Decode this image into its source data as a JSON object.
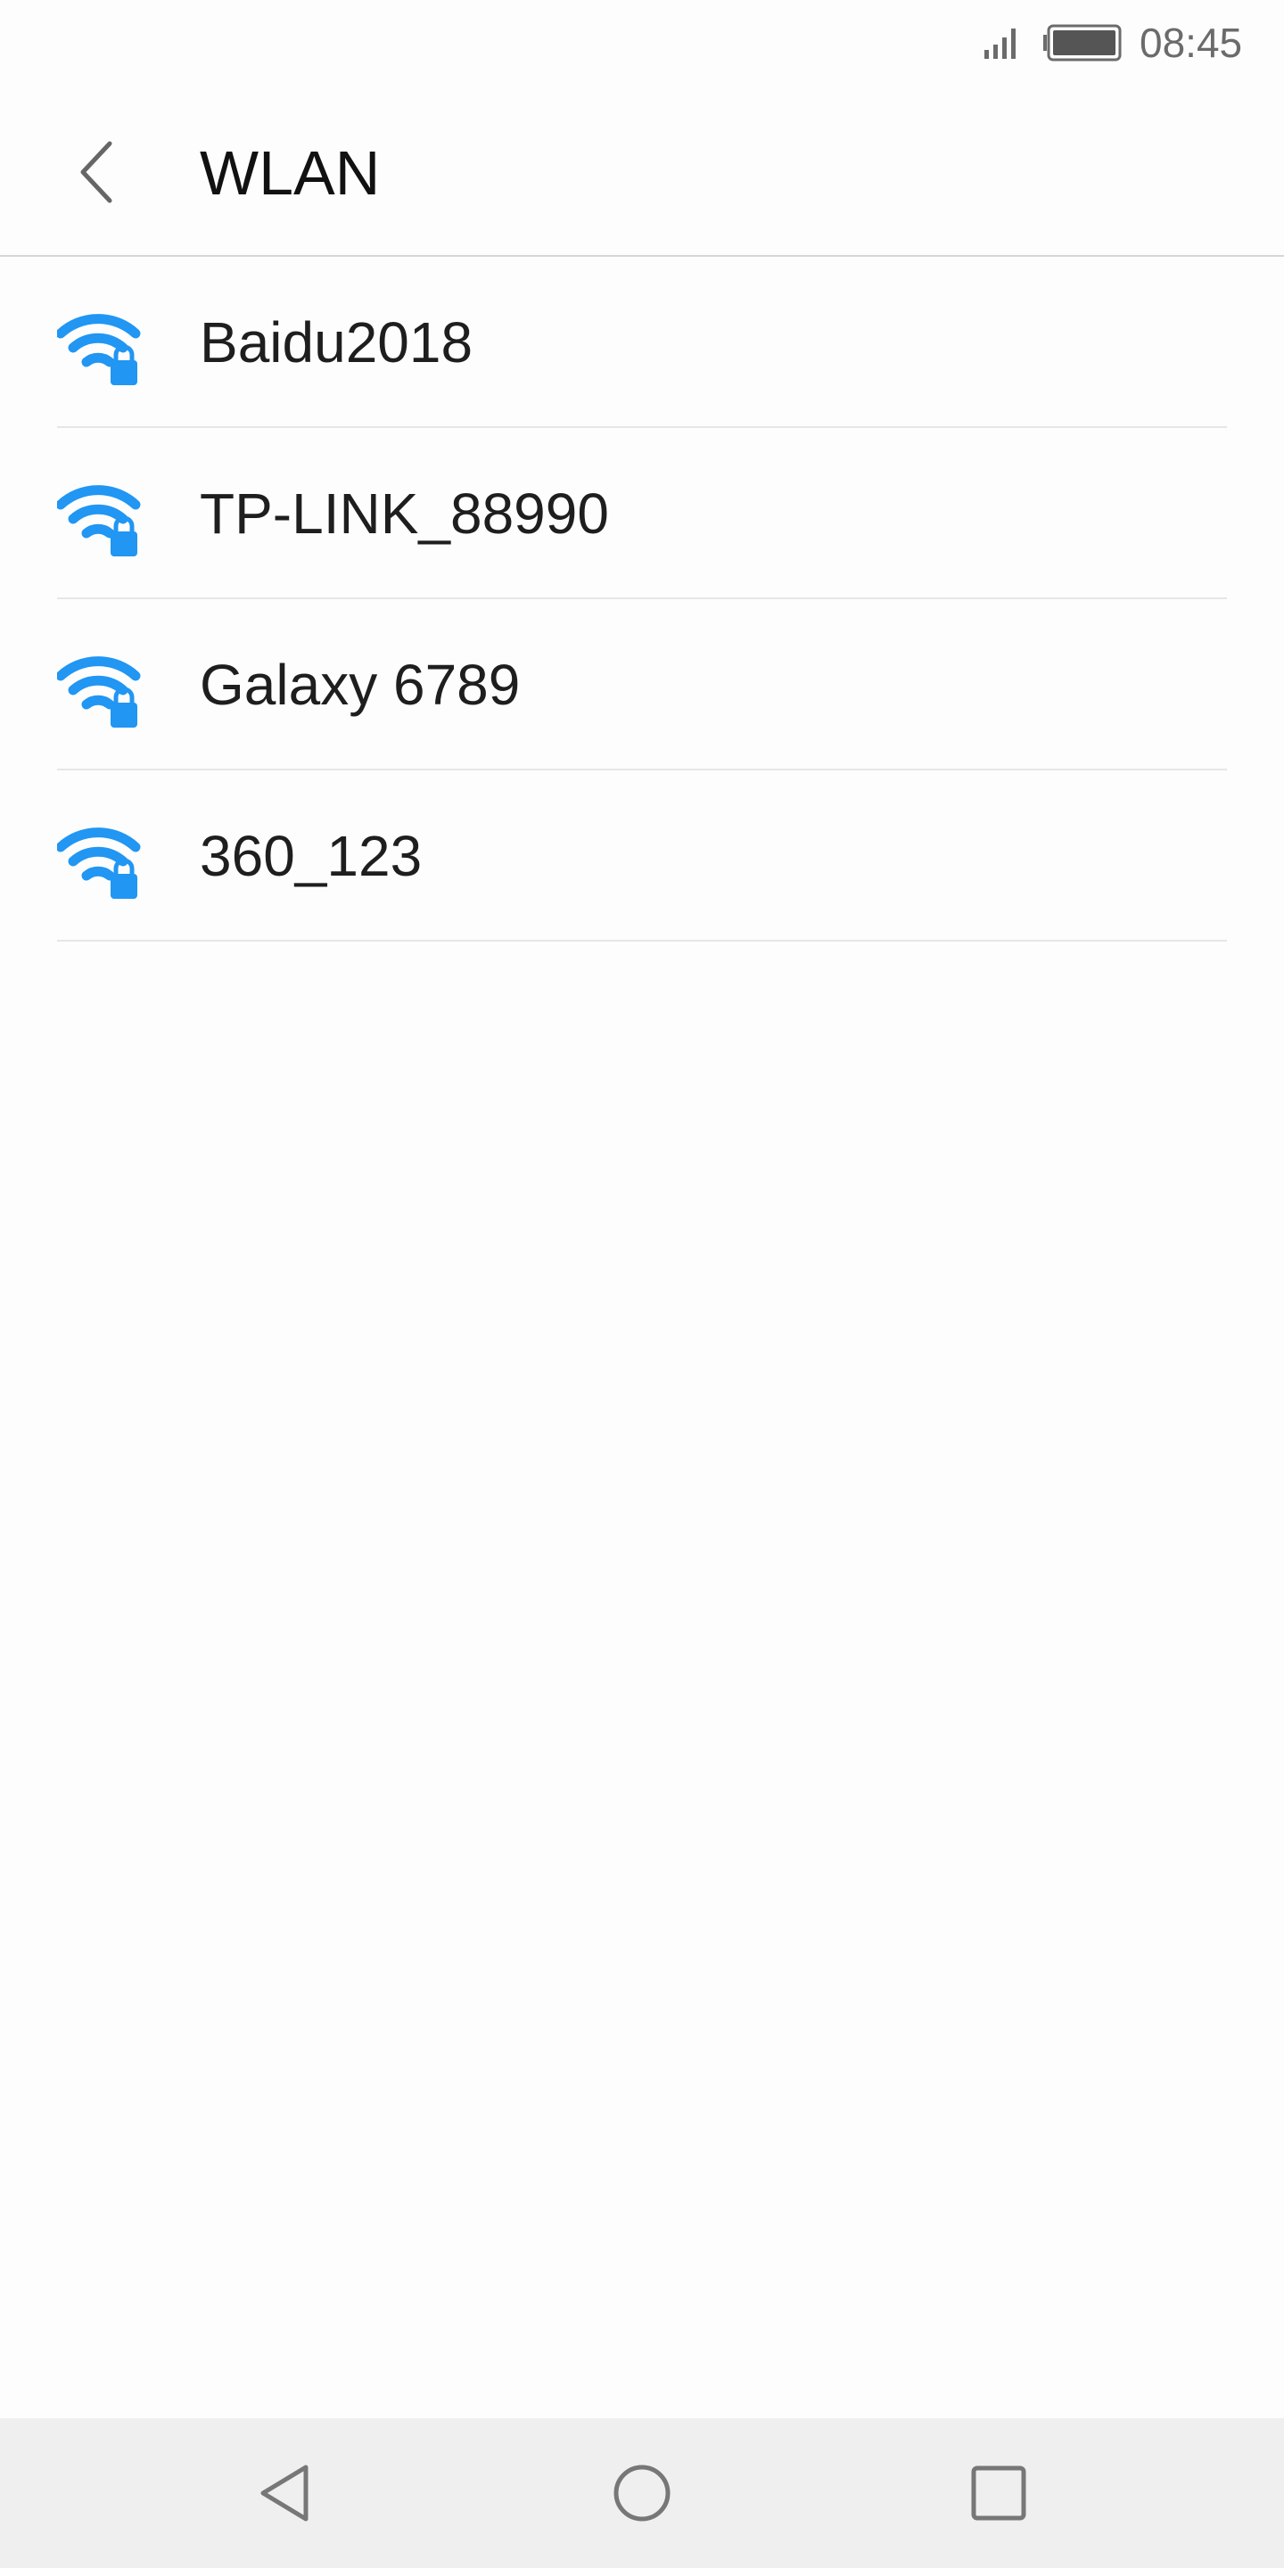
{
  "status_bar": {
    "time": "08:45",
    "icons": [
      "signal-icon",
      "battery-icon"
    ]
  },
  "header": {
    "title": "WLAN",
    "back_icon": "chevron-left-icon"
  },
  "wlan": {
    "networks": [
      {
        "ssid": "Baidu2018",
        "secured": true
      },
      {
        "ssid": "TP-LINK_88990",
        "secured": true
      },
      {
        "ssid": "Galaxy 6789",
        "secured": true
      },
      {
        "ssid": "360_123",
        "secured": true
      }
    ]
  },
  "colors": {
    "wifi_blue": "#2196f3",
    "text_primary": "#1e1e1e",
    "divider": "#e6e6e6",
    "nav_bar": "#efefef"
  },
  "nav_bar": {
    "buttons": [
      "back-triangle-icon",
      "home-circle-icon",
      "recent-square-icon"
    ]
  }
}
